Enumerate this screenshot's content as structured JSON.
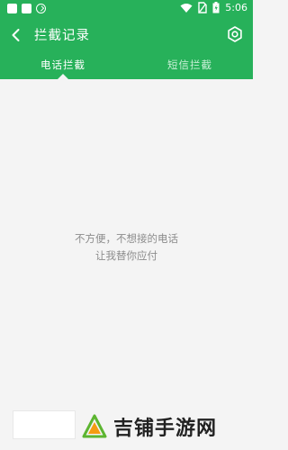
{
  "status_bar": {
    "time": "5:06",
    "left_icons": [
      "notification-square-icon",
      "notification-square-icon",
      "sync-circle-icon"
    ],
    "right_icons": [
      "wifi-icon",
      "no-sim-icon",
      "battery-icon"
    ]
  },
  "header": {
    "title": "拦截记录",
    "back_icon": "back-arrow-icon",
    "settings_icon": "gear-icon"
  },
  "tabs": [
    {
      "label": "电话拦截",
      "active": true
    },
    {
      "label": "短信拦截",
      "active": false
    }
  ],
  "empty_state": {
    "line1": "不方便，不想接的电话",
    "line2": "让我替你应付"
  },
  "watermark": {
    "text": "吉铺手游网"
  },
  "colors": {
    "brand_green": "#27b15a",
    "background": "#f4f4f4",
    "muted_text": "#8c8c8c"
  }
}
